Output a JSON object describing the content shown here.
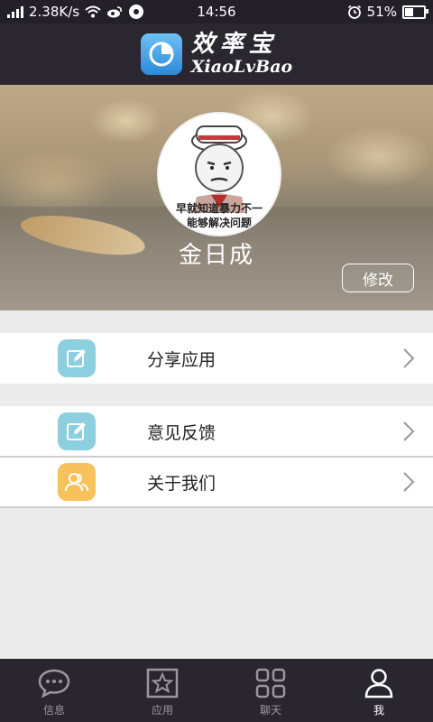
{
  "status_bar": {
    "speed": "2.38K/s",
    "time": "14:56",
    "battery": "51%",
    "battery_level": 0.51
  },
  "header": {
    "app_name_cn": "效率宝",
    "app_name_en": "XiaoLvBao",
    "logo_color": "#2c8ad9"
  },
  "profile": {
    "avatar_caption_1": "早就知道暴力不一",
    "avatar_caption_2": "能够解决问题",
    "username": "金日成",
    "edit_label": "修改"
  },
  "menu": {
    "share": {
      "label": "分享应用",
      "icon": "edit-icon",
      "color": "#8ccfdf"
    },
    "feedback": {
      "label": "意见反馈",
      "icon": "edit-icon",
      "color": "#8ccfdf"
    },
    "about": {
      "label": "关于我们",
      "icon": "people-icon",
      "color": "#f7c15c"
    }
  },
  "tabbar": {
    "items": [
      {
        "label": "信息",
        "icon": "chat-bubble-icon"
      },
      {
        "label": "应用",
        "icon": "star-icon"
      },
      {
        "label": "聊天",
        "icon": "grid-icon"
      },
      {
        "label": "我",
        "icon": "person-icon"
      }
    ],
    "active": "我"
  }
}
